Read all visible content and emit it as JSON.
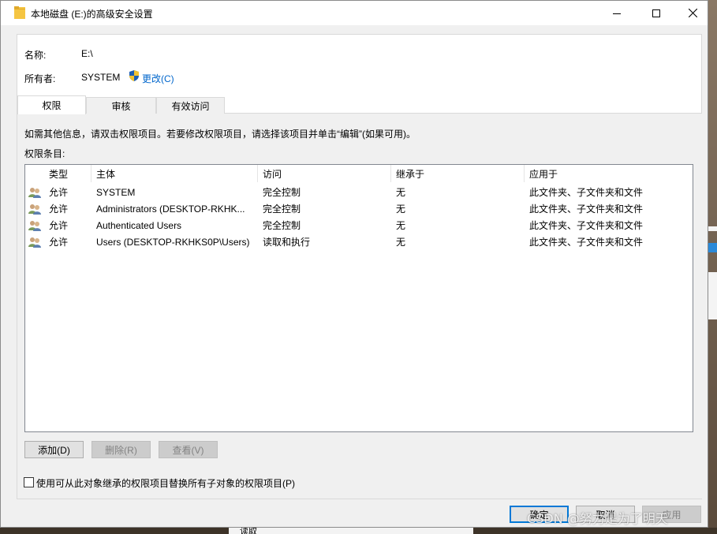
{
  "window": {
    "title": "本地磁盘 (E:)的高级安全设置",
    "folder_icon_color": "#f5c542"
  },
  "info": {
    "name_label": "名称:",
    "name_value": "E:\\",
    "owner_label": "所有者:",
    "owner_value": "SYSTEM",
    "change_link": "更改(C)"
  },
  "tabs": [
    {
      "label": "权限",
      "active": true
    },
    {
      "label": "审核",
      "active": false
    },
    {
      "label": "有效访问",
      "active": false
    }
  ],
  "permissions": {
    "hint": "如需其他信息，请双击权限项目。若要修改权限项目，请选择该项目并单击“编辑”(如果可用)。",
    "entries_label": "权限条目:",
    "columns": [
      "类型",
      "主体",
      "访问",
      "继承于",
      "应用于"
    ],
    "rows": [
      {
        "type": "允许",
        "principal": "SYSTEM",
        "access": "完全控制",
        "inherited": "无",
        "applies": "此文件夹、子文件夹和文件"
      },
      {
        "type": "允许",
        "principal": "Administrators (DESKTOP-RKHK...",
        "access": "完全控制",
        "inherited": "无",
        "applies": "此文件夹、子文件夹和文件"
      },
      {
        "type": "允许",
        "principal": "Authenticated Users",
        "access": "完全控制",
        "inherited": "无",
        "applies": "此文件夹、子文件夹和文件"
      },
      {
        "type": "允许",
        "principal": "Users (DESKTOP-RKHKS0P\\Users)",
        "access": "读取和执行",
        "inherited": "无",
        "applies": "此文件夹、子文件夹和文件"
      }
    ],
    "add_button": "添加(D)",
    "remove_button": "删除(R)",
    "view_button": "查看(V)",
    "replace_checkbox": "使用可从此对象继承的权限项目替换所有子对象的权限项目(P)",
    "replace_checked": false
  },
  "footer": {
    "ok_button": "确定",
    "cancel_button": "取消",
    "apply_button": "应用"
  },
  "background": {
    "bottom_text": "读取",
    "watermark": "CSDN @努力是为了明天"
  },
  "colors": {
    "accent": "#0078d7",
    "link": "#0066cc"
  }
}
